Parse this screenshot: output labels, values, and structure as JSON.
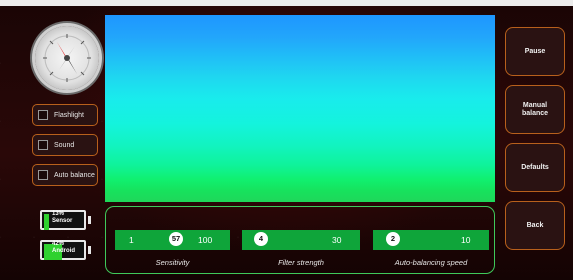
{
  "controls": {
    "flashlight": {
      "label": "Flashlight",
      "checked": false
    },
    "sound": {
      "label": "Sound",
      "checked": false
    },
    "auto_balance": {
      "label": "Auto balance",
      "checked": false
    }
  },
  "batteries": {
    "sensor": {
      "percent_text": "13%",
      "label": "Sensor",
      "level": 0.13
    },
    "android": {
      "percent_text": "42%",
      "label": "Android",
      "level": 0.42
    }
  },
  "sliders": {
    "sensitivity": {
      "min": "1",
      "value": "57",
      "max": "100",
      "caption": "Sensitivity"
    },
    "filter_strength": {
      "value": "4",
      "max": "30",
      "caption": "Filter strength"
    },
    "auto_balancing_speed": {
      "value": "2",
      "max": "10",
      "caption": "Auto-balancing speed"
    }
  },
  "buttons": {
    "pause": "Pause",
    "manual_balance": "Manual\nbalance",
    "defaults": "Defaults",
    "back": "Back"
  },
  "colors": {
    "accent_border": "#b8601c",
    "slider_green": "#0fa53a",
    "panel_border": "#3fc95a"
  }
}
